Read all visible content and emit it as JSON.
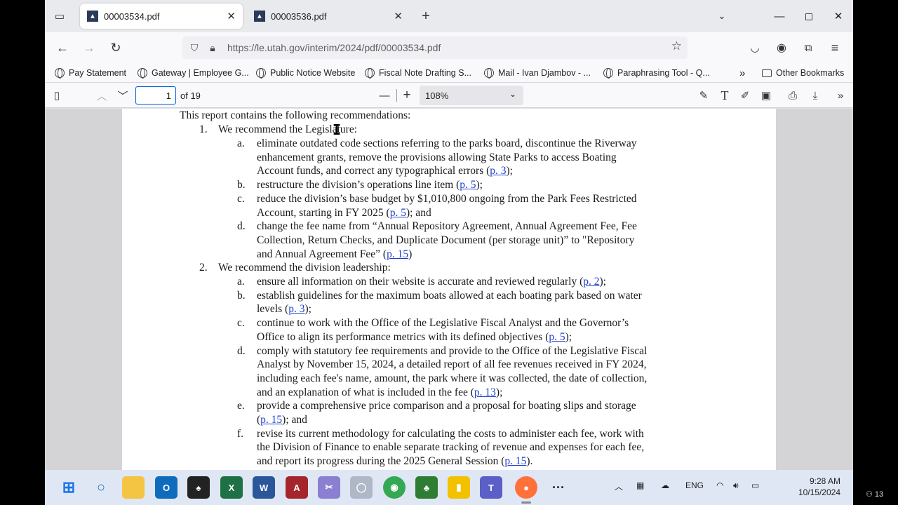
{
  "browser": {
    "tabs": [
      {
        "title": "00003534.pdf",
        "active": true
      },
      {
        "title": "00003536.pdf",
        "active": false
      }
    ],
    "new_tab_symbol": "+",
    "url": "https://le.utah.gov/interim/2024/pdf/00003534.pdf",
    "bookmarks": [
      "Pay Statement",
      "Gateway | Employee G...",
      "Public Notice Website",
      "Fiscal Note Drafting S...",
      "Mail - Ivan Djambov - ...",
      "Paraphrasing Tool - Q..."
    ],
    "other_bookmarks": "Other Bookmarks",
    "overflow_symbol": "»"
  },
  "pdf_toolbar": {
    "page_current": "1",
    "page_count": "of 19",
    "zoom": "108%",
    "zoom_minus": "—",
    "zoom_plus": "+"
  },
  "document": {
    "intro": "This report contains the following recommendations:",
    "rec1": {
      "num": "1.",
      "text": "We recommend the Legislature:",
      "items": [
        {
          "letter": "a.",
          "lines": [
            {
              "text": "eliminate outdated code sections referring to the parks board, discontinue the Riverway"
            },
            {
              "text": "enhancement grants, remove the provisions allowing State Parks to access Boating"
            },
            {
              "text": "Account funds, and correct any typographical errors (",
              "link": "p. 3",
              "after": ");"
            }
          ]
        },
        {
          "letter": "b.",
          "lines": [
            {
              "text": "restructure the division’s operations line item (",
              "link": "p. 5",
              "after": ");"
            }
          ]
        },
        {
          "letter": "c.",
          "lines": [
            {
              "text": "reduce the division’s base budget by $1,010,800 ongoing from the Park Fees Restricted"
            },
            {
              "text": "Account, starting in FY 2025 (",
              "link": "p. 5",
              "after": "); and"
            }
          ]
        },
        {
          "letter": "d.",
          "lines": [
            {
              "text": "change the fee name from “Annual Repository Agreement, Annual Agreement Fee, Fee"
            },
            {
              "text": "Collection, Return Checks, and Duplicate Document (per storage unit)” to \"Repository"
            },
            {
              "text": "and Annual Agreement Fee” (",
              "link": "p. 15",
              "after": ")"
            }
          ]
        }
      ]
    },
    "rec2": {
      "num": "2.",
      "text": "We recommend the division leadership:",
      "items": [
        {
          "letter": "a.",
          "lines": [
            {
              "text": "ensure all information on their website is accurate and reviewed regularly (",
              "link": "p. 2",
              "after": ");"
            }
          ]
        },
        {
          "letter": "b.",
          "lines": [
            {
              "text": "establish guidelines for the maximum boats allowed at each boating park based on water"
            },
            {
              "text": "levels (",
              "link": "p. 3",
              "after": ");"
            }
          ]
        },
        {
          "letter": "c.",
          "lines": [
            {
              "text": "continue to work with the Office of the Legislative Fiscal Analyst and the Governor’s"
            },
            {
              "text": "Office to align its performance metrics with its defined objectives (",
              "link": "p. 5",
              "after": ");"
            }
          ]
        },
        {
          "letter": "d.",
          "lines": [
            {
              "text": "comply with statutory fee requirements and provide to the Office of the Legislative Fiscal"
            },
            {
              "text": "Analyst by November 15, 2024, a detailed report of all fee revenues received in FY 2024,"
            },
            {
              "text": "including each fee's name, amount, the park where it was collected, the date of collection,"
            },
            {
              "text": "and an explanation of what is included in the fee (",
              "link": "p. 13",
              "after": ");"
            }
          ]
        },
        {
          "letter": "e.",
          "lines": [
            {
              "text": "provide a comprehensive price comparison and a proposal for boating slips and storage"
            },
            {
              "text": "(",
              "link": "p. 15",
              "after": "); and"
            }
          ]
        },
        {
          "letter": "f.",
          "lines": [
            {
              "text": "revise its current methodology for calculating the costs to administer each fee, work with"
            },
            {
              "text": "the Division of Finance to enable separate tracking of revenue and expenses for each fee,"
            },
            {
              "text": "and report its progress during the 2025 General Session (",
              "link": "p. 15",
              "after": ")."
            }
          ]
        }
      ]
    }
  },
  "taskbar": {
    "language": "ENG",
    "time": "9:28 AM",
    "date": "10/15/2024",
    "badge": "13"
  }
}
